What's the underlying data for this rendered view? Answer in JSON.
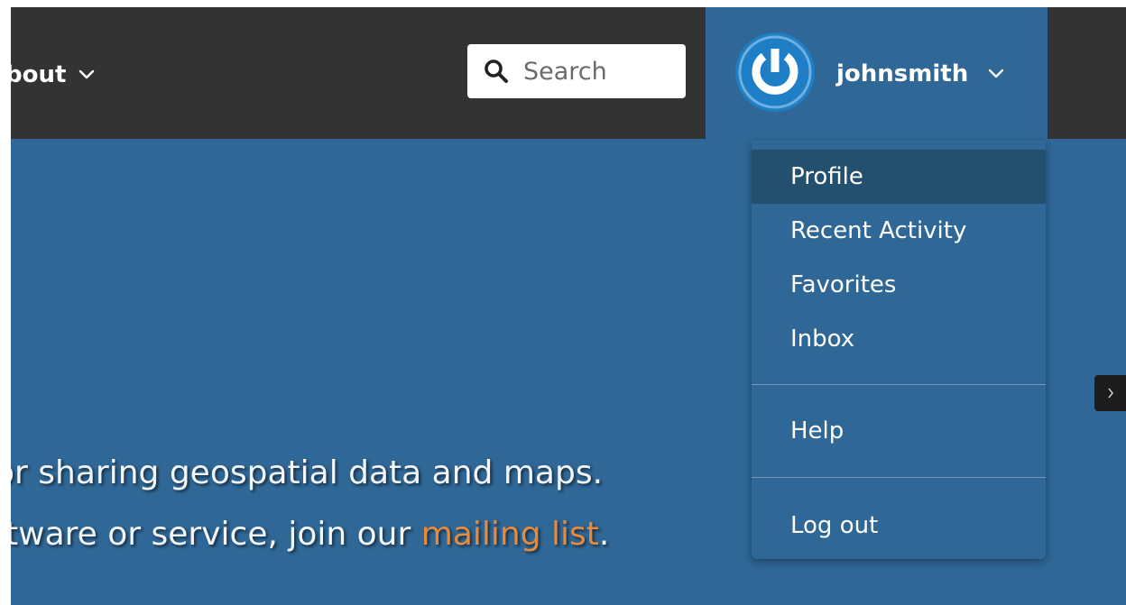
{
  "nav": {
    "about_label": "bout"
  },
  "search": {
    "placeholder": "Search"
  },
  "user": {
    "username": "johnsmith"
  },
  "dropdown": {
    "items": [
      {
        "label": "Profile"
      },
      {
        "label": "Recent Activity"
      },
      {
        "label": "Favorites"
      },
      {
        "label": "Inbox"
      }
    ],
    "help_label": "Help",
    "logout_label": "Log out"
  },
  "hero": {
    "line1": "or sharing geospatial data and maps.",
    "line2_before": "ftware or service, join our ",
    "line2_link": "mailing list",
    "line2_after": "."
  },
  "colors": {
    "topbar": "#333333",
    "brand_blue": "#2f6796",
    "menu_active": "#24506f",
    "link_orange": "#e58a3e"
  },
  "icons": {
    "search": "search-icon",
    "avatar": "power-icon",
    "dropdown": "chevron-down-icon",
    "side_tab": "chevron-right-icon"
  }
}
